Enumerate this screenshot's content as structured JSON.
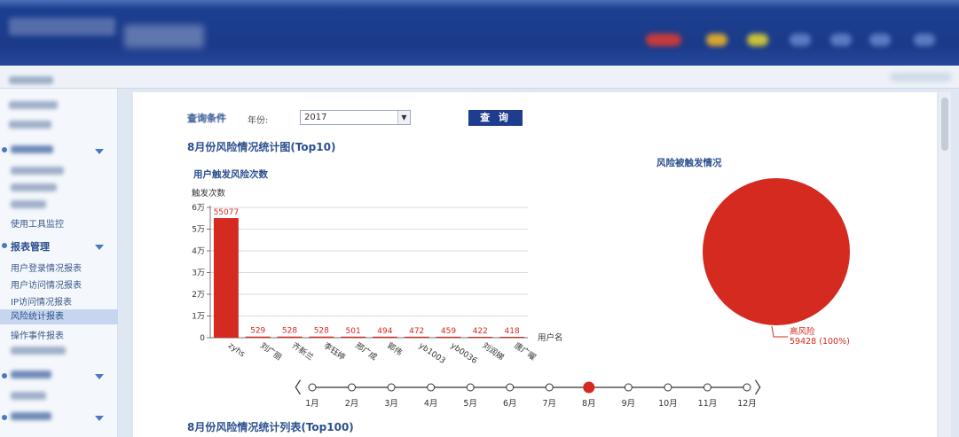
{
  "sidebar": {
    "group_report": "报表管理",
    "items": [
      {
        "label": "用户登录情况报表"
      },
      {
        "label": "用户访问情况报表"
      },
      {
        "label": "IP访问情况报表"
      },
      {
        "label": "风险统计报表",
        "active": true
      },
      {
        "label": "操作事件报表"
      }
    ],
    "upper_item": "使用工具监控"
  },
  "query": {
    "label": "查询条件",
    "year_label": "年份:",
    "year_value": "2017",
    "button": "查 询"
  },
  "section1_title": "8月份风险情况统计图(Top10)",
  "section2_title": "8月份风险情况统计列表(Top100)",
  "chart_data": [
    {
      "type": "bar",
      "title": "用户触发风险次数",
      "ylabel": "触发次数",
      "xlabel": "用户名",
      "categories": [
        "zyhs",
        "刘广丽",
        "齐新兰",
        "李钰婷",
        "邢广成",
        "郭伟",
        "yb1003",
        "yb0036",
        "刘润娣",
        "唐广曜"
      ],
      "values": [
        55077,
        529,
        528,
        528,
        501,
        494,
        472,
        459,
        422,
        418
      ],
      "yticks": [
        "0",
        "1万",
        "2万",
        "3万",
        "4万",
        "5万",
        "6万"
      ],
      "ylim": [
        0,
        60000
      ],
      "color": "#d42a20"
    },
    {
      "type": "pie",
      "title": "风险被触发情况",
      "slices": [
        {
          "name": "高风险",
          "value": 59428,
          "label": "59428 (100%)"
        }
      ],
      "color": "#d42a20"
    }
  ],
  "timeline": {
    "months": [
      "1月",
      "2月",
      "3月",
      "4月",
      "5月",
      "6月",
      "7月",
      "8月",
      "9月",
      "10月",
      "11月",
      "12月"
    ],
    "selected_index": 7,
    "prev": "〈",
    "next": "〉"
  }
}
